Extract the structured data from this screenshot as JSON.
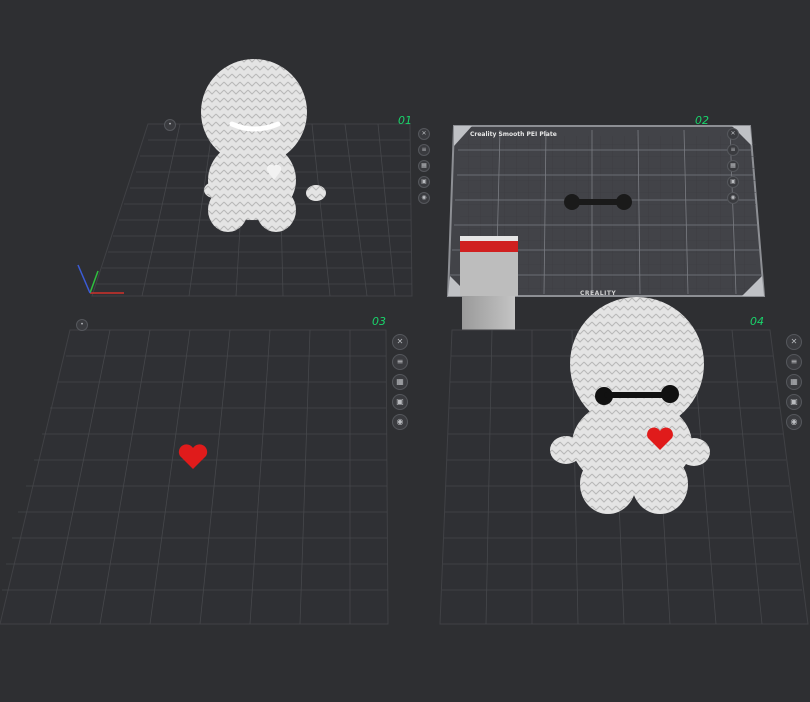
{
  "plates": [
    {
      "label": "01",
      "tools": [
        "close-icon",
        "layers-icon",
        "arrange-icon",
        "lock-icon",
        "settings-icon"
      ]
    },
    {
      "label": "02",
      "header": "Creality Smooth PEI Plate",
      "brand": "CREALITY",
      "tools": [
        "close-icon",
        "layers-icon",
        "arrange-icon",
        "lock-icon",
        "settings-icon"
      ]
    },
    {
      "label": "03",
      "tools": [
        "close-icon",
        "layers-icon",
        "arrange-icon",
        "lock-icon",
        "settings-icon"
      ]
    },
    {
      "label": "04",
      "tools": [
        "close-icon",
        "layers-icon",
        "arrange-icon",
        "lock-icon",
        "settings-icon"
      ]
    }
  ],
  "colors": {
    "background": "#2e2f32",
    "grid_line": "#4a4b4f",
    "plate_label": "#19d46b",
    "model_white": "#e4e4e4",
    "heart_red": "#e01b1b",
    "axis_x": "#d0302a",
    "axis_y": "#2fbf3f",
    "axis_z": "#3b5bd6"
  }
}
